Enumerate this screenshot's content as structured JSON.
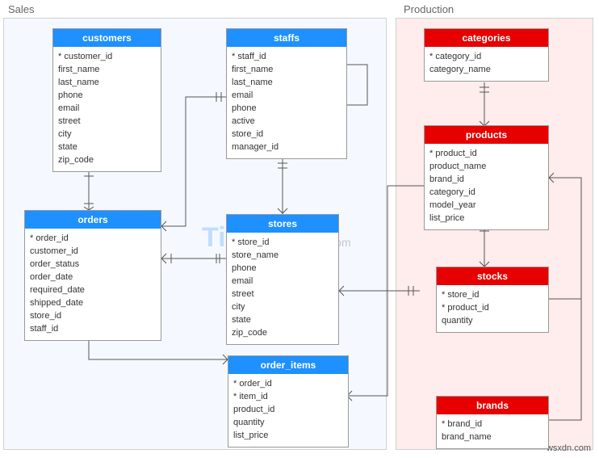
{
  "sections": {
    "sales": {
      "label": "Sales"
    },
    "production": {
      "label": "Production"
    }
  },
  "entities": {
    "customers": {
      "title": "customers",
      "fields": [
        "* customer_id",
        "first_name",
        "last_name",
        "phone",
        "email",
        "street",
        "city",
        "state",
        "zip_code"
      ]
    },
    "staffs": {
      "title": "staffs",
      "fields": [
        "* staff_id",
        "first_name",
        "last_name",
        "email",
        "phone",
        "active",
        "store_id",
        "manager_id"
      ]
    },
    "orders": {
      "title": "orders",
      "fields": [
        "* order_id",
        "customer_id",
        "order_status",
        "order_date",
        "required_date",
        "shipped_date",
        "store_id",
        "staff_id"
      ]
    },
    "stores": {
      "title": "stores",
      "fields": [
        "* store_id",
        "store_name",
        "phone",
        "email",
        "street",
        "city",
        "state",
        "zip_code"
      ]
    },
    "order_items": {
      "title": "order_items",
      "fields": [
        "* order_id",
        "* item_id",
        "product_id",
        "quantity",
        "list_price"
      ]
    },
    "categories": {
      "title": "categories",
      "fields": [
        "* category_id",
        "category_name"
      ]
    },
    "products": {
      "title": "products",
      "fields": [
        "* product_id",
        "product_name",
        "brand_id",
        "category_id",
        "model_year",
        "list_price"
      ]
    },
    "stocks": {
      "title": "stocks",
      "fields": [
        "* store_id",
        "* product_id",
        "quantity"
      ]
    },
    "brands": {
      "title": "brands",
      "fields": [
        "* brand_id",
        "brand_name"
      ]
    }
  },
  "watermark": {
    "main": "TipsMake",
    "suffix": ".com",
    "site": "wsxdn.com"
  }
}
